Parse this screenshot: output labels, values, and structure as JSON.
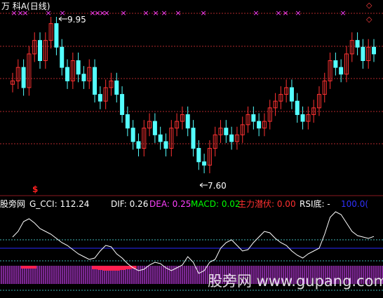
{
  "top_panel": {
    "title": "万  科A(日线)",
    "high_label": "9.95",
    "low_label": "7.60",
    "signal_glyph": "×",
    "corner_glyph": "◇"
  },
  "indicator_bar": {
    "site": "股旁网",
    "cci_label": "G_CCI: 112.24",
    "dif_label": "DIF: 0.26",
    "dea_label": "DEA: 0.25",
    "macd_label": "MACD: 0.02",
    "main_label": "主力潜伏: 0.00",
    "rsi_label": "RSI底: -",
    "rsi_value": "100.0("
  },
  "dollar_sign": "$",
  "watermark": "股旁网 www.gupang.com",
  "colors": {
    "up": "#ff3232",
    "down": "#54ffff",
    "grid": "#b0272d",
    "signal": "#ff40ff",
    "cci_line": "#ffffff",
    "blue_line": "#2a2aff",
    "dashed": "#3fb3b3",
    "hist": "#cc44ff",
    "main_bar": "#ff2050",
    "dif": "#ffffff",
    "dea": "#ff40ff",
    "macd": "#00ff00",
    "main_text": "#ff3030",
    "rsi_value": "#3030ff"
  },
  "chart_data": [
    {
      "type": "candlestick",
      "y_high": 9.95,
      "y_low": 7.6,
      "closes": [
        9.0,
        9.2,
        8.9,
        9.4,
        9.6,
        9.3,
        9.6,
        9.85,
        9.5,
        9.2,
        9.0,
        9.3,
        9.1,
        9.0,
        9.2,
        8.8,
        8.7,
        8.9,
        9.0,
        8.8,
        8.5,
        8.3,
        8.1,
        8.0,
        8.3,
        8.4,
        8.2,
        8.1,
        8.0,
        8.3,
        8.4,
        8.5,
        8.3,
        8.0,
        7.8,
        7.75,
        8.0,
        8.2,
        8.3,
        8.2,
        8.1,
        8.2,
        8.35,
        8.5,
        8.4,
        8.3,
        8.4,
        8.6,
        8.7,
        8.8,
        8.9,
        8.7,
        8.5,
        8.4,
        8.5,
        8.6,
        8.8,
        9.0,
        9.3,
        9.2,
        9.1,
        9.4,
        9.6,
        9.5,
        9.3,
        9.5,
        9.4
      ]
    },
    {
      "type": "line",
      "name": "G_CCI",
      "values": [
        40,
        60,
        95,
        105,
        90,
        70,
        60,
        50,
        35,
        20,
        10,
        -5,
        -20,
        -30,
        -40,
        -35,
        -10,
        10,
        5,
        -20,
        -35,
        -55,
        -70,
        -80,
        -75,
        -60,
        -50,
        -55,
        -70,
        -80,
        -70,
        -60,
        -30,
        -50,
        -90,
        -80,
        -50,
        -40,
        0,
        20,
        30,
        10,
        -10,
        -5,
        20,
        40,
        60,
        55,
        35,
        20,
        10,
        -10,
        -25,
        -35,
        -20,
        -10,
        0,
        50,
        110,
        130,
        120,
        90,
        60,
        45,
        40,
        35,
        42
      ]
    },
    {
      "type": "bar",
      "name": "主力潜伏",
      "values": [
        0,
        0,
        0,
        0,
        0,
        0,
        0,
        0,
        0,
        0,
        0,
        0,
        0,
        0,
        0,
        5,
        6,
        7,
        7,
        7,
        6,
        5,
        4,
        0,
        0,
        0,
        0,
        0,
        0,
        0,
        0,
        0,
        0,
        0,
        0,
        0,
        0,
        0,
        0,
        0,
        0,
        0,
        0,
        0,
        0,
        0,
        0,
        0,
        0,
        0,
        0,
        0,
        0,
        0,
        0,
        0,
        0,
        0,
        0,
        0,
        0,
        0,
        0,
        0,
        0,
        0,
        0
      ]
    }
  ]
}
